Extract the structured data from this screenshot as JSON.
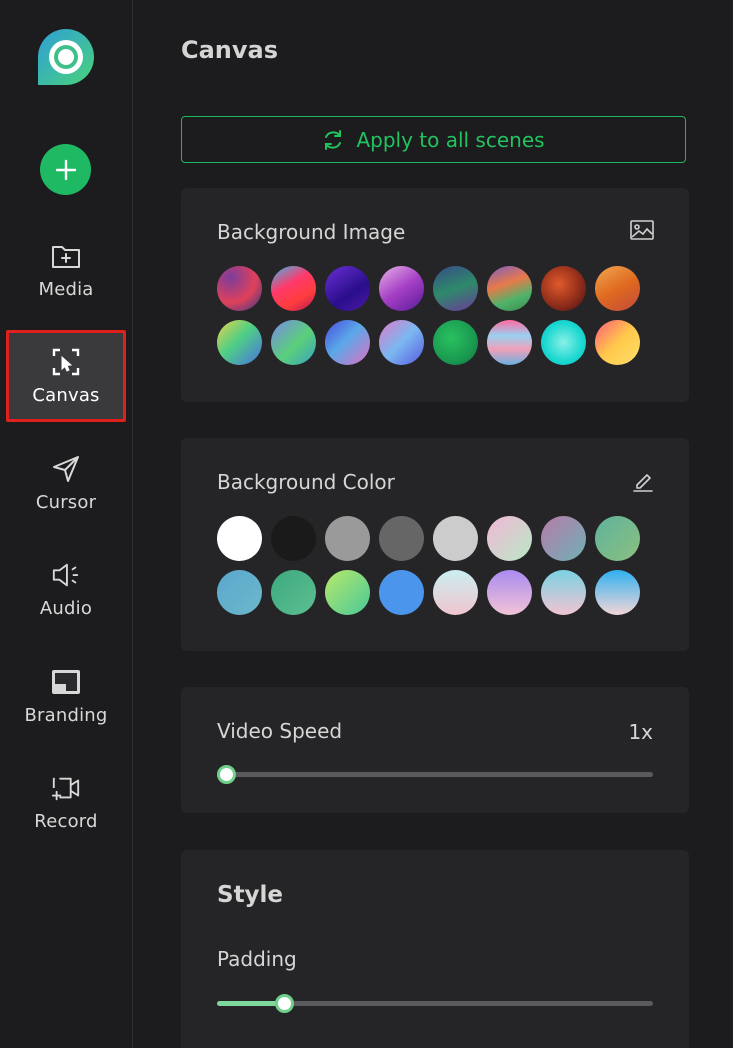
{
  "sidebar": {
    "logo_icon": "app-logo",
    "add_icon": "plus-icon",
    "items": [
      {
        "label": "Media",
        "icon": "folder-add-icon"
      },
      {
        "label": "Canvas",
        "icon": "canvas-cursor-icon",
        "active": true
      },
      {
        "label": "Cursor",
        "icon": "send-icon"
      },
      {
        "label": "Audio",
        "icon": "speaker-icon"
      },
      {
        "label": "Branding",
        "icon": "branding-icon"
      },
      {
        "label": "Record",
        "icon": "record-add-icon"
      }
    ]
  },
  "main": {
    "title": "Canvas",
    "apply_button": {
      "label": "Apply to all scenes",
      "icon": "refresh-icon"
    },
    "background_image": {
      "title": "Background Image",
      "action_icon": "image-icon"
    },
    "background_color": {
      "title": "Background Color",
      "action_icon": "pencil-icon",
      "swatches": [
        "#ffffff",
        "#1a1a1a",
        "#9a9a9a",
        "#666666",
        "#cccccc",
        "linear-gradient(135deg,#f2b7d8,#b8e8c4)",
        "linear-gradient(135deg,#b77ba8,#6fb0b6)",
        "linear-gradient(135deg,#5fb29c,#8bc07f)",
        "linear-gradient(135deg,#5aa7d0,#6cb8c9)",
        "linear-gradient(135deg,#3da87c,#5cc094)",
        "linear-gradient(135deg,#b8e86a,#49c999)",
        "#4b96ec",
        "linear-gradient(180deg,#cbeef0,#f0c5cf)",
        "linear-gradient(180deg,#a98bf0,#f2c3d6)",
        "linear-gradient(180deg,#7bd2e3,#f1c4d2)",
        "linear-gradient(180deg,#2fb0f0,#f4d6d8)"
      ]
    },
    "video_speed": {
      "label": "Video Speed",
      "value_text": "1x",
      "value": 0
    },
    "style": {
      "title": "Style",
      "padding": {
        "label": "Padding",
        "value": 0.14
      }
    }
  },
  "colors": {
    "accent": "#1fb964",
    "active_outline": "#e0201c",
    "panel": "#252527",
    "background": "#1c1c1e"
  }
}
